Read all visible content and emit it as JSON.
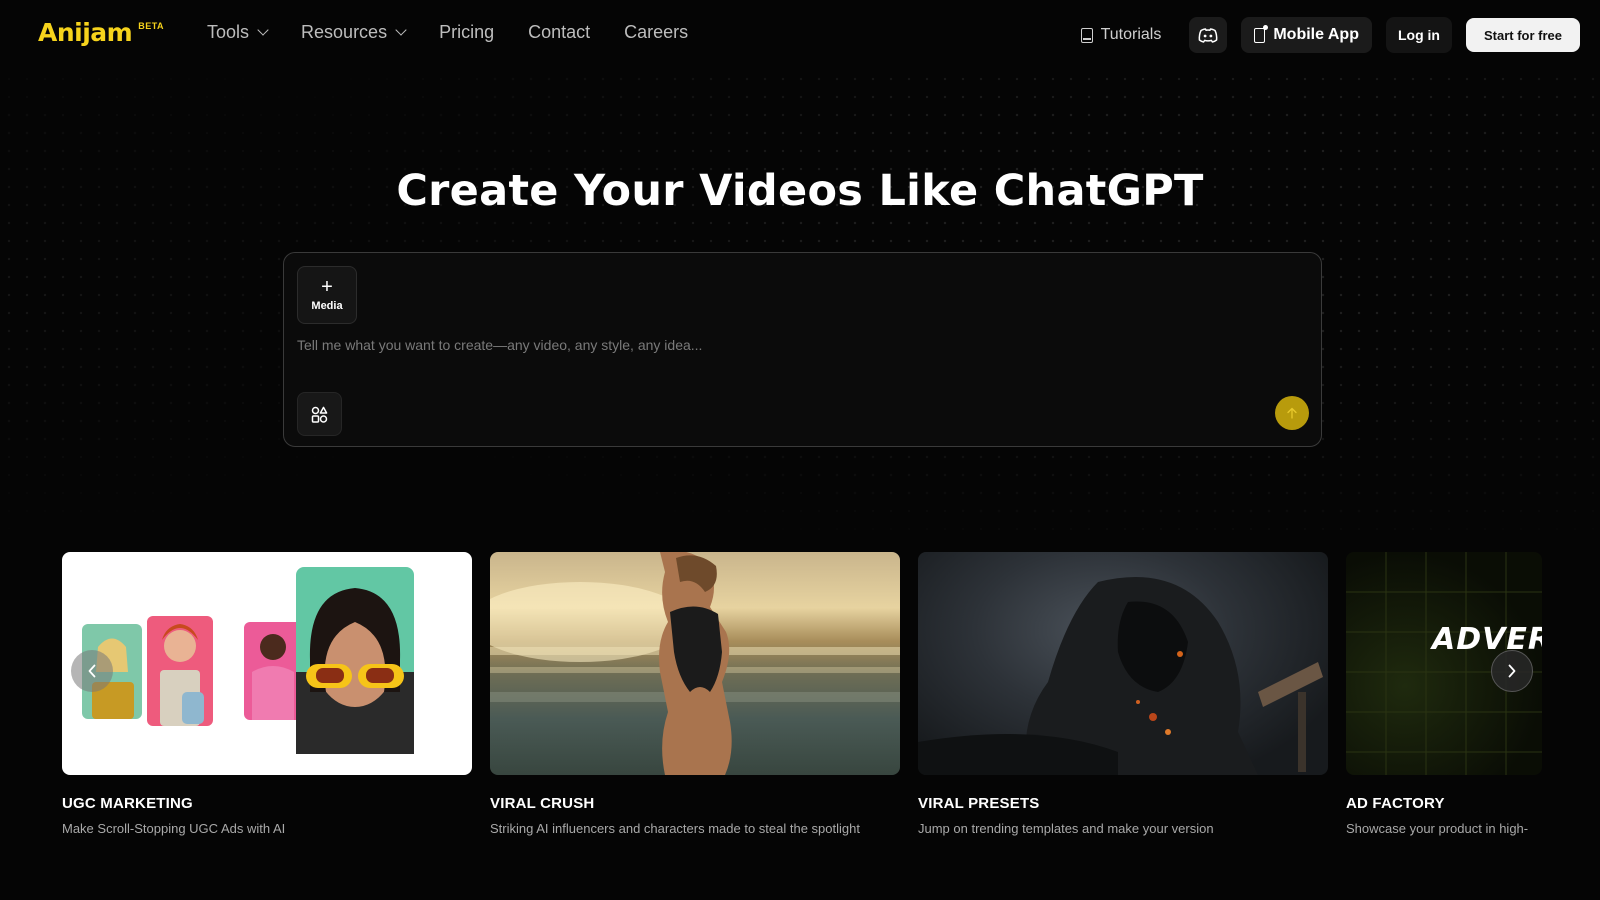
{
  "nav": {
    "logo": "Anijam",
    "badge": "BETA",
    "links": [
      {
        "label": "Tools",
        "dropdown": true
      },
      {
        "label": "Resources",
        "dropdown": true
      },
      {
        "label": "Pricing",
        "dropdown": false
      },
      {
        "label": "Contact",
        "dropdown": false
      },
      {
        "label": "Careers",
        "dropdown": false
      }
    ],
    "tutorials": "Tutorials",
    "discord_icon": "discord-icon",
    "mobile_app": "Mobile App",
    "login": "Log in",
    "start": "Start for free"
  },
  "hero": {
    "title": "Create Your Videos Like ChatGPT",
    "media_label": "Media",
    "placeholder": "Tell me what you want to create—any video, any style, any idea...",
    "send_icon": "arrow-up-icon",
    "tools_icon": "shapes-icon"
  },
  "cards": [
    {
      "title": "UGC MARKETING",
      "desc": "Make Scroll-Stopping UGC Ads with AI"
    },
    {
      "title": "VIRAL CRUSH",
      "desc": "Striking AI influencers and characters made to steal the spotlight"
    },
    {
      "title": "VIRAL PRESETS",
      "desc": "Jump on trending templates and make your version"
    },
    {
      "title": "AD FACTORY",
      "desc": "Showcase your product in high-",
      "thumb_text": "ADVER"
    }
  ],
  "colors": {
    "accent": "#f6d31c",
    "send": "#b89b0c",
    "background": "#050505"
  }
}
